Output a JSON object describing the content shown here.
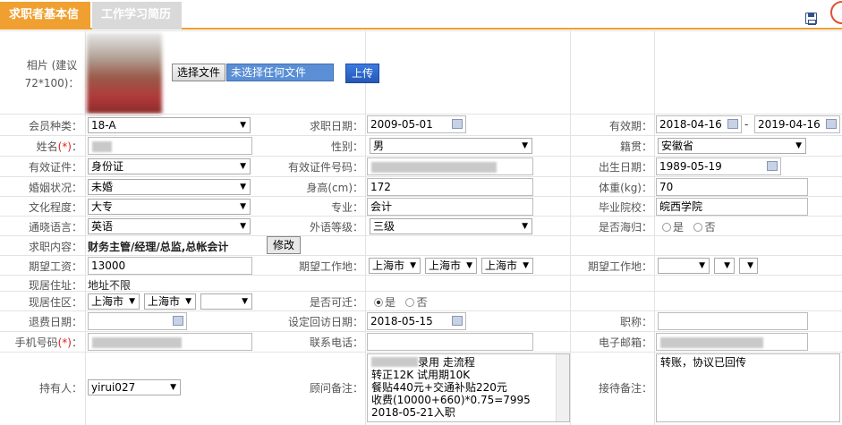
{
  "tabs": {
    "active": "求职者基本信息",
    "inactive": "工作学习简历"
  },
  "photo": {
    "label": "相片 (建议72*100)：",
    "choose_file": "选择文件",
    "no_file": "未选择任何文件",
    "upload": "上传"
  },
  "r1": {
    "member_label": "会员种类：",
    "member": "18-A",
    "apply_date_label": "求职日期：",
    "apply_date": "2009-05-01",
    "valid_label": "有效期：",
    "valid_from": "2018-04-16",
    "dash": "-",
    "valid_to": "2019-04-16"
  },
  "r2": {
    "name_label": "姓名",
    "name_req": "(*)",
    "colon": "：",
    "gender_label": "性别：",
    "gender": "男",
    "origin_label": "籍贯：",
    "origin": "安徽省"
  },
  "r3": {
    "id_type_label": "有效证件：",
    "id_type": "身份证",
    "id_no_label": "有效证件号码：",
    "birth_label": "出生日期：",
    "birth": "1989-05-19"
  },
  "r4": {
    "marital_label": "婚姻状况：",
    "marital": "未婚",
    "height_label": "身高(cm)：",
    "height": "172",
    "weight_label": "体重(kg)：",
    "weight": "70"
  },
  "r5": {
    "edu_label": "文化程度：",
    "edu": "大专",
    "major_label": "专业：",
    "major": "会计",
    "school_label": "毕业院校：",
    "school": "皖西学院"
  },
  "r6": {
    "lang_label": "通晓语言：",
    "lang": "英语",
    "lang_level_label": "外语等级：",
    "lang_level": "三级",
    "overseas_label": "是否海归：",
    "yes": "是",
    "no": "否"
  },
  "r7": {
    "content_label": "求职内容：",
    "content": "财务主管/经理/总监,总帐会计",
    "edit": "修改"
  },
  "r8": {
    "salary_label": "期望工资：",
    "salary": "13000",
    "work_loc_label": "期望工作地：",
    "city1": "上海市",
    "city2": "上海市",
    "city3": "上海市",
    "work_loc2_label": "期望工作地："
  },
  "r9": {
    "addr_label": "现居住址：",
    "addr": "地址不限"
  },
  "r10": {
    "area_label": "现居住区：",
    "area1": "上海市",
    "area2": "上海市",
    "move_label": "是否可迁：",
    "yes": "是",
    "no": "否"
  },
  "r11": {
    "refund_label": "退费日期：",
    "visit_label": "设定回访日期：",
    "visit": "2018-05-15",
    "title_label": "职称："
  },
  "r12": {
    "phone_label": "手机号码",
    "phone_req": "(*)",
    "colon": "：",
    "contact_label": "联系电话：",
    "email_label": "电子邮箱："
  },
  "r13": {
    "holder_label": "持有人：",
    "holder": "yirui027",
    "advisor_label": "顾问备注：",
    "advisor_lines": [
      "录用 走流程",
      "转正12K 试用期10K",
      "餐贴440元+交通补贴220元",
      "收费(10000+660)*0.75=7995",
      "2018-05-21入职"
    ],
    "reception_label": "接待备注：",
    "reception": "转账，协议已回传"
  }
}
